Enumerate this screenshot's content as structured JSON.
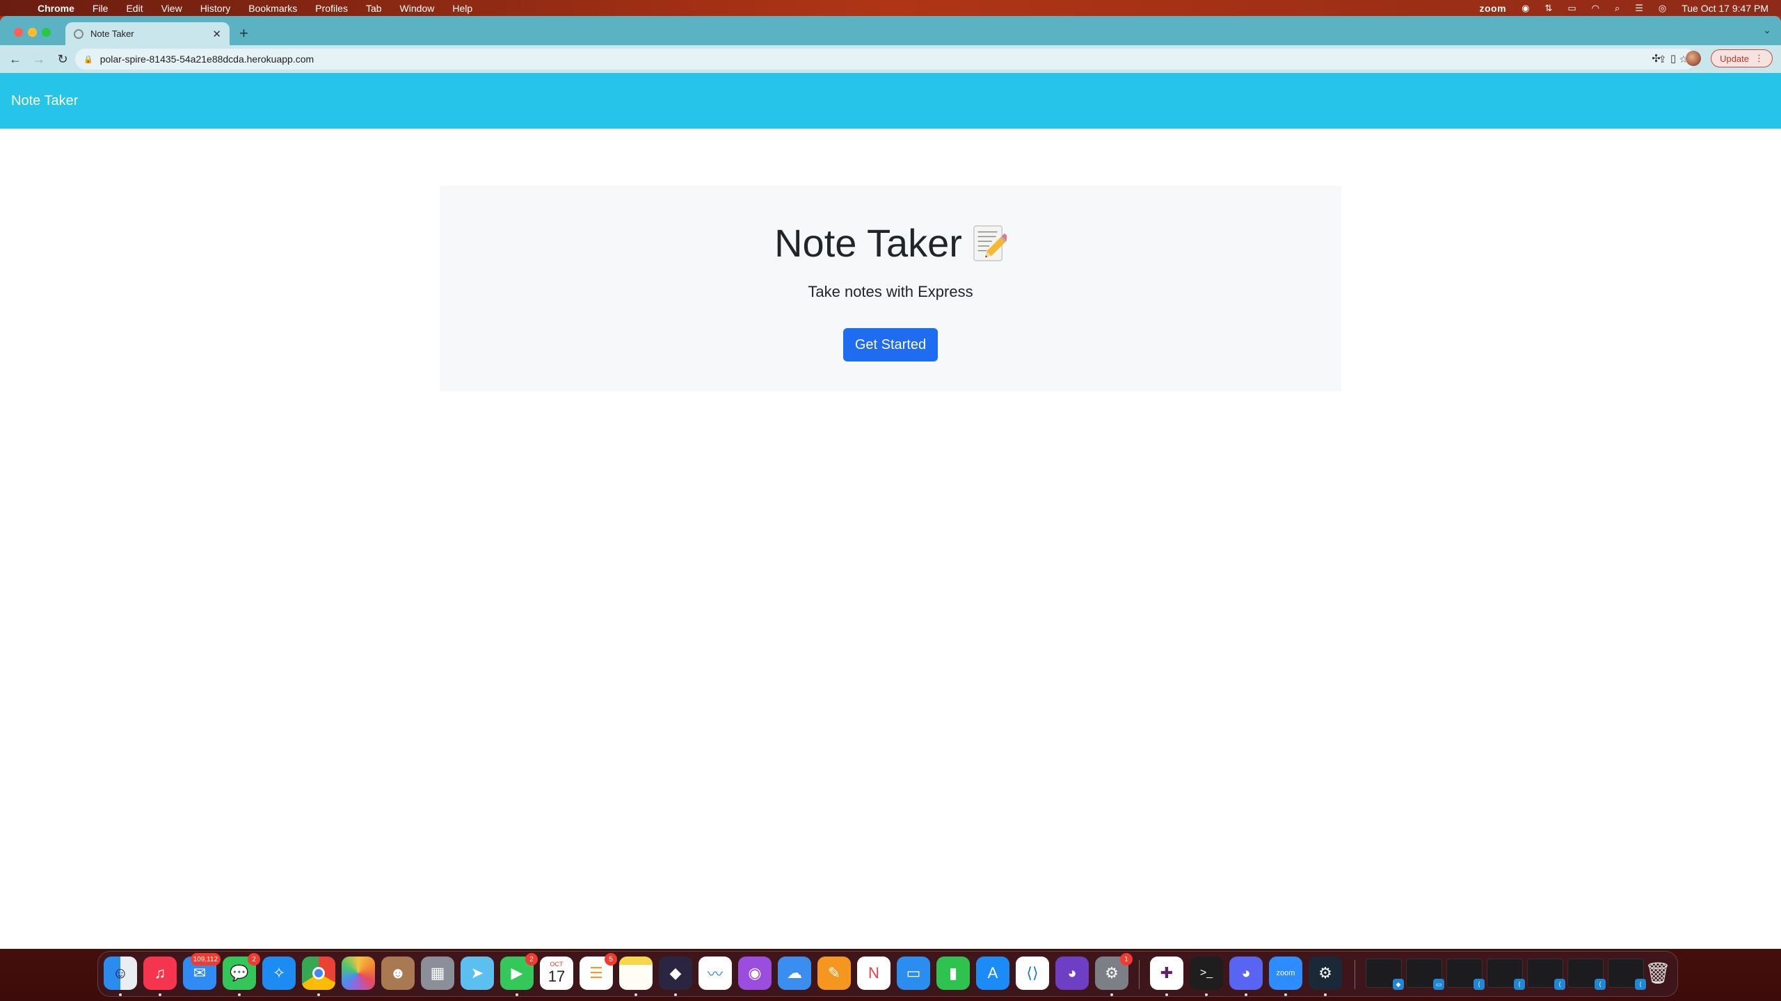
{
  "menubar": {
    "app_name": "Chrome",
    "menus": [
      "File",
      "Edit",
      "View",
      "History",
      "Bookmarks",
      "Profiles",
      "Tab",
      "Window",
      "Help"
    ],
    "zoom_label": "zoom",
    "datetime": "Tue Oct 17  9:47 PM"
  },
  "browser": {
    "tab_title": "Note Taker",
    "url": "polar-spire-81435-54a21e88dcda.herokuapp.com",
    "update_label": "Update"
  },
  "page": {
    "brand": "Note Taker",
    "hero_title": "Note Taker",
    "hero_subtitle": "Take notes with Express",
    "cta_label": "Get Started"
  },
  "dock": {
    "mail_badge": "109,112",
    "messages_badge": "2",
    "facetime_badge": "2",
    "calendar_month": "OCT",
    "calendar_day": "17",
    "reminders_badge": "5",
    "settings_badge": "1",
    "zoom_label": "zoom"
  },
  "colors": {
    "navbar": "#25c4e8",
    "cta": "#1f6cf0",
    "jumbotron": "#f7f8f9"
  }
}
